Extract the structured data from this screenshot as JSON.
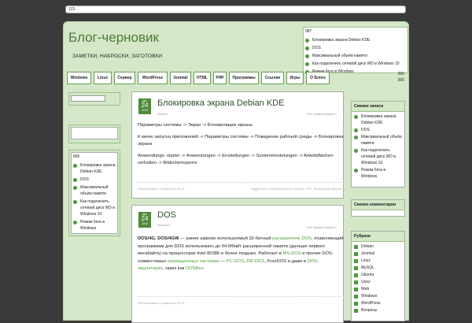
{
  "topbar": {
    "value": "123"
  },
  "site": {
    "title": "Блог-черновик",
    "description": "ЗАМЕТКИ, НАБРОСКИ, ЗАГОТОВКИ"
  },
  "recent_top": {
    "count": "987",
    "items": [
      "Блокировка экрана Debian KDE",
      "DOS",
      "Максимальный объём памяти",
      "Как подключить сетевой диск WD в Windows 10",
      "Режим бога в Windows"
    ]
  },
  "nav": {
    "items": [
      "Windows",
      "Linux",
      "Сервер",
      "WordPress",
      "Joomla!",
      "HTML",
      "PHP",
      "Программы",
      "Ссылки",
      "Игры",
      "О Блоге"
    ],
    "count1": "365",
    "count2": "365"
  },
  "left_sidebar": {
    "count": "895",
    "items": [
      "Блокировка экрана Debian KDE",
      "DOS",
      "Максимальный объём памяти",
      "Как подключить сетевой диск WD в Windows 10",
      "Режим бога в Windows"
    ]
  },
  "posts": [
    {
      "date_month": "Дек",
      "date_day": "24",
      "date_year": "2018",
      "title": "Блокировка экрана Debian KDE",
      "comments": "Нет комментариев »",
      "category": "Debian",
      "p1": "Параметры системы -> Экран -> Блокировщик экрана.",
      "p2": "К меню запуска приложений -> Параметры системы -> Поведение рабочей среды -> Блокировка экрана",
      "p3": "Anwendungs- starter -> Anwendungen -> Einstellungen -> Systemeinstelungen -> Arbeitsflächen-verhalten -> Bildschirmsperre",
      "foot_left": "Опубликовано Странник в 20:31",
      "foot_tags": "Tagged with: Bildschirmsperre, debian, KDE, блокировка экрана"
    },
    {
      "date_month": "Дек",
      "date_day": "24",
      "date_year": "2018",
      "title": "DOS",
      "comments": "Нет комментариев »",
      "category": "Всячина",
      "b_bold": "DOS/4G, DOS/4GW",
      "b1": " — ранее широко используемый 32-битный ",
      "l1": "расширитель DOS",
      "b2": ", позволяющий программам для DOS использовать до 64 Мбайт расширенной памяти (дальше первого мегабайта) на процессорах Intel 80386 и более поздних. Работает в ",
      "l2": "MS-DOS",
      "b3": " и прочих DOS-совместимых ",
      "l3": "операционных системах",
      "b4": " — ",
      "l4": "PC-DOS",
      "b5": ", ",
      "l5": "DR-DOS",
      "b6": ", FreeDOS и даже в ",
      "l6": "DOS-эмуляторах",
      "b7": ", таких как ",
      "l7": "DOSBox",
      "b8": ".",
      "foot_left": "Опубликовано Странник в 19:37"
    }
  ],
  "right_sidebar": {
    "recent_head": "Свежие записи",
    "recent": [
      "Блокировка экрана Debian KDE",
      "DOS",
      "Максимальный объём памяти",
      "Как подключить сетевой диск WD в Windows 10",
      "Режим бога в Windows"
    ],
    "comments_head": "Свежие комментарии",
    "cats_head": "Рубрики",
    "cats": [
      "Debian",
      "Joomla!",
      "Linux",
      "MySQL",
      "Ubuntu",
      "Uooz",
      "Web",
      "Windows",
      "WordPress",
      "Вопросы"
    ]
  },
  "colors": {
    "accent": "#4d9a3a",
    "header_bg": "#d4e8c8",
    "page_bg": "#3a3a3a"
  }
}
